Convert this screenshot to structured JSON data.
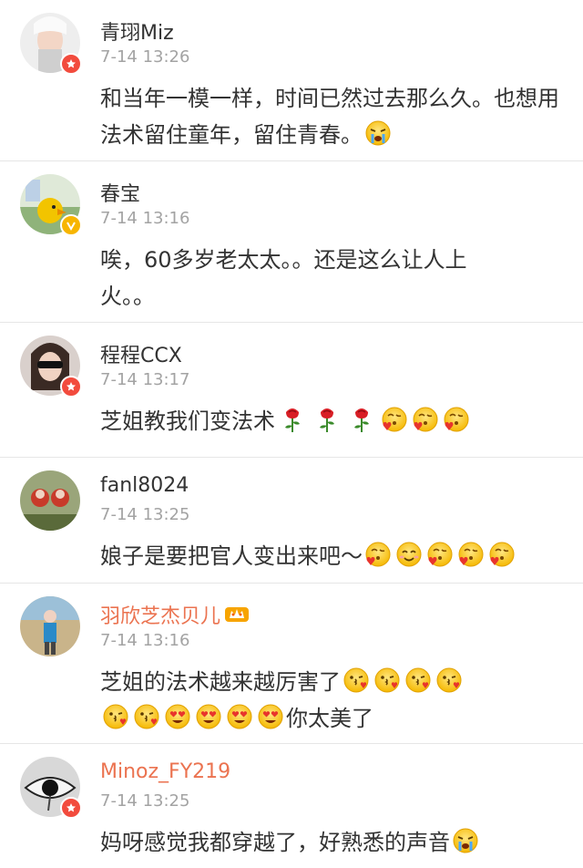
{
  "comments": [
    {
      "username": "青珝Miz",
      "time": "7-14 13:26",
      "text": "和当年一模一样，时间已然过去那么久。也想用法术留住童年，留住青春。",
      "emoji_trailing": [
        "crying-face"
      ],
      "badge": "red-v"
    },
    {
      "username": "春宝",
      "time": "7-14 13:16",
      "text_line1": "唉，60多岁老太太。。还是这么让人上",
      "text_line2": "火。。",
      "badge": "gold-v"
    },
    {
      "username": "程程CCX",
      "time": "7-14 13:17",
      "text": "芝姐教我们变法术",
      "emoji_trailing": [
        "rose",
        "rose",
        "rose",
        "kissing-heart-face",
        "kissing-heart-face",
        "kissing-heart-face"
      ],
      "badge": "red-v"
    },
    {
      "username": "fanl8024",
      "time": "7-14 13:25",
      "text": "娘子是要把官人变出来吧～",
      "emoji_trailing": [
        "kissing-heart-face",
        "smiling-face",
        "kissing-heart-face",
        "kissing-heart-face",
        "kissing-heart-face"
      ]
    },
    {
      "username": "羽欣芝杰贝儿",
      "time": "7-14 13:16",
      "text_line1": "芝姐的法术越来越厉害了",
      "text_line2_suffix": "你太美了",
      "emoji_line1": [
        "face-blowing-kiss",
        "face-blowing-kiss",
        "face-blowing-kiss",
        "face-blowing-kiss"
      ],
      "emoji_line2": [
        "face-blowing-kiss",
        "face-blowing-kiss",
        "heart-eyes-face",
        "heart-eyes-face",
        "heart-eyes-face",
        "heart-eyes-face"
      ],
      "vip_icon": "member-crown-icon",
      "username_color": "#eb7350"
    },
    {
      "username": "Minoz_FY219",
      "time": "7-14 13:25",
      "text": "妈呀感觉我都穿越了，好熟悉的声音",
      "emoji_trailing": [
        "crying-face"
      ],
      "badge": "red-v",
      "username_color": "#eb7350"
    }
  ],
  "colors": {
    "username_default": "#333333",
    "username_member": "#eb7350",
    "timestamp": "#a3a3a3",
    "badge_red": "#f24b3d",
    "badge_gold": "#f7b500"
  }
}
